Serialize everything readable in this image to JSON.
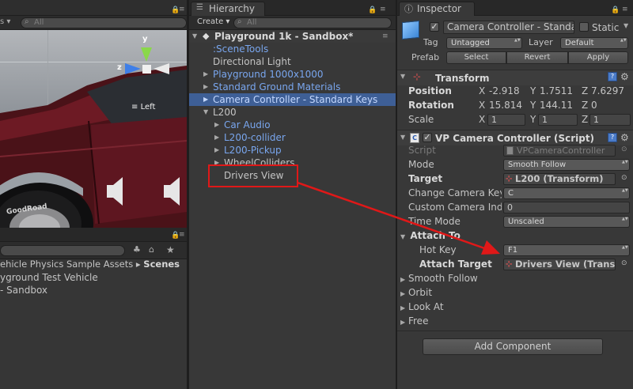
{
  "scene": {
    "search_placeholder": "All",
    "orientation_label": "Left",
    "axis_y": "y",
    "axis_z": "z",
    "tire_text": "GoodRoad"
  },
  "project": {
    "breadcrumb_left": "ehicle Physics Sample Assets",
    "breadcrumb_sep": "▸",
    "breadcrumb_current": "Scenes",
    "items": [
      "yground Test Vehicle",
      "- Sandbox"
    ]
  },
  "hierarchy": {
    "tab": "Hierarchy",
    "create": "Create ▾",
    "search_placeholder": "All",
    "scene_name": "Playground 1k - Sandbox*",
    "rows": [
      {
        "label": ":SceneTools"
      },
      {
        "label": "Directional Light"
      },
      {
        "label": "Playground 1000x1000"
      },
      {
        "label": "Standard Ground Materials"
      },
      {
        "label": "Camera Controller - Standard Keys"
      },
      {
        "label": "L200"
      },
      {
        "label": "Car Audio"
      },
      {
        "label": "L200-collider"
      },
      {
        "label": "L200-Pickup"
      },
      {
        "label": "WheelColliders"
      },
      {
        "label": "Drivers View"
      }
    ]
  },
  "inspector": {
    "tab": "Inspector",
    "object_name": "Camera Controller - Standa",
    "static_label": "Static",
    "tag_label": "Tag",
    "tag_value": "Untagged",
    "layer_label": "Layer",
    "layer_value": "Default",
    "prefab_label": "Prefab",
    "prefab_select": "Select",
    "prefab_revert": "Revert",
    "prefab_apply": "Apply",
    "transform": {
      "title": "Transform",
      "position_label": "Position",
      "rotation_label": "Rotation",
      "scale_label": "Scale",
      "position": [
        "-2.918",
        "1.7511",
        "7.6297"
      ],
      "rotation": [
        "15.814",
        "144.11",
        "0"
      ],
      "scale": [
        "1",
        "1",
        "1"
      ],
      "x": "X",
      "y": "Y",
      "z": "Z"
    },
    "camera": {
      "title": "VP Camera Controller (Script)",
      "script_label": "Script",
      "script_value": "VPCameraController",
      "mode_label": "Mode",
      "mode_value": "Smooth Follow",
      "target_label": "Target",
      "target_value": "L200 (Transform)",
      "change_key_label": "Change Camera Key",
      "change_key_value": "C",
      "custom_index_label": "Custom Camera Index",
      "custom_index_value": "0",
      "time_mode_label": "Time Mode",
      "time_mode_value": "Unscaled",
      "attach_to_label": "Attach To",
      "hot_key_label": "Hot Key",
      "hot_key_value": "F1",
      "attach_target_label": "Attach Target",
      "attach_target_value": "Drivers View (Trans",
      "smooth_follow_label": "Smooth Follow",
      "orbit_label": "Orbit",
      "look_at_label": "Look At",
      "free_label": "Free"
    },
    "add_component": "Add Component"
  },
  "colors": {
    "annotation": "#e01818",
    "selection": "#3e5f96",
    "prefab_text": "#79a6ee"
  }
}
